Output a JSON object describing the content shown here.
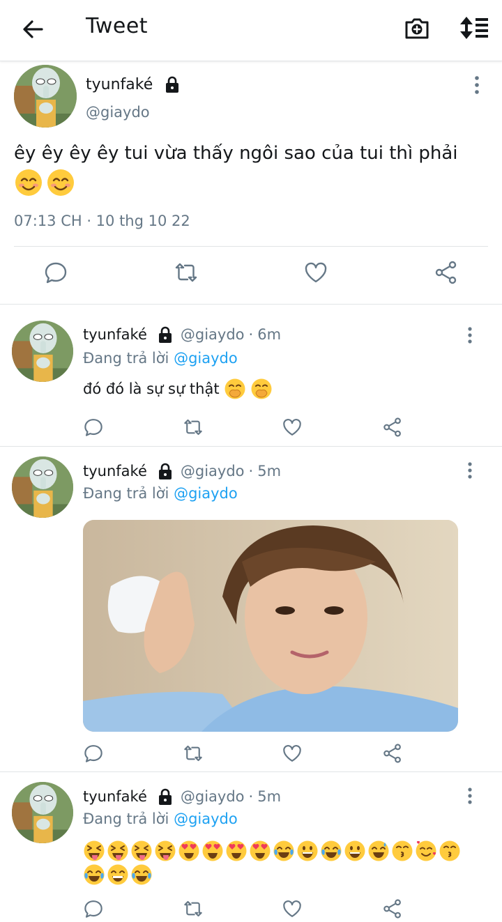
{
  "header": {
    "title": "Tweet"
  },
  "main_tweet": {
    "name": "tyunfaké",
    "handle": "@giaydo",
    "text": "êy êy êy êy tui vừa thấy ngôi sao của tui thì phải",
    "emojis": [
      "smiling-face-with-smiling-eyes",
      "smiling-face-with-smiling-eyes"
    ],
    "timestamp": "07:13 CH · 10 thg 10 22"
  },
  "replies": [
    {
      "name": "tyunfaké",
      "handle": "@giaydo",
      "sep": "·",
      "time": "6m",
      "replying_prefix": "Đang trả lời",
      "replying_to": "@giaydo",
      "text": "đó đó là sự sự thật",
      "emojis": [
        "face-with-hand-over-mouth",
        "face-with-hand-over-mouth"
      ]
    },
    {
      "name": "tyunfaké",
      "handle": "@giaydo",
      "sep": "·",
      "time": "5m",
      "replying_prefix": "Đang trả lời",
      "replying_to": "@giaydo",
      "media": "photo-of-person-raising-fist"
    },
    {
      "name": "tyunfaké",
      "handle": "@giaydo",
      "sep": "·",
      "time": "5m",
      "replying_prefix": "Đang trả lời",
      "replying_to": "@giaydo",
      "emojis": [
        "squinting-tongue",
        "squinting-tongue",
        "squinting-tongue",
        "squinting-tongue",
        "heart-eyes",
        "heart-eyes",
        "heart-eyes",
        "heart-eyes",
        "tears-of-joy",
        "grinning-face",
        "tears-of-joy",
        "grinning-face",
        "grinning-sweat",
        "kissing-face",
        "smiling-hearts",
        "kissing-face",
        "tears-of-joy",
        "beaming-face",
        "tears-of-joy"
      ]
    }
  ],
  "colors": {
    "accent": "#1da1f2",
    "muted": "#657786",
    "text": "#14171a",
    "divider": "#e1e4e6",
    "icon": "#657786"
  }
}
